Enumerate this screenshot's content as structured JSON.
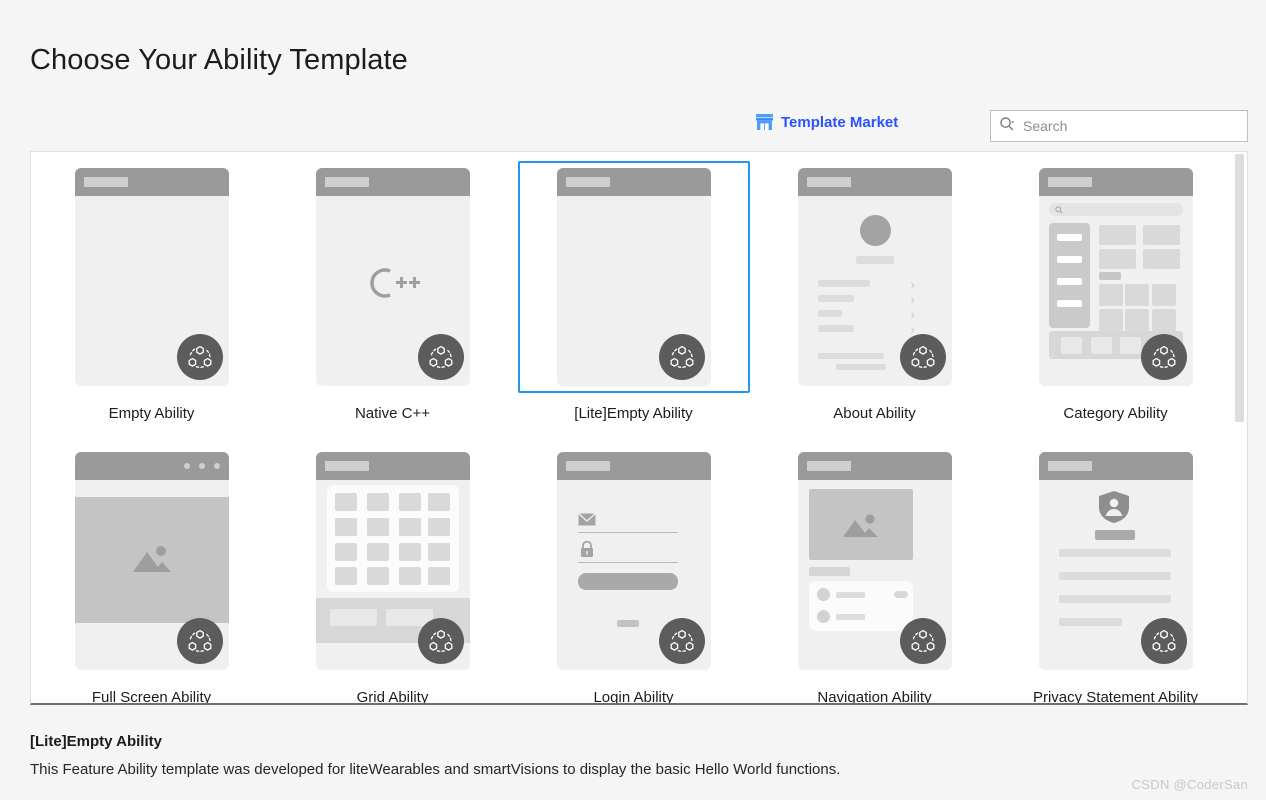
{
  "page": {
    "title": "Choose Your Ability Template",
    "background": "#f5f5f5"
  },
  "toolbar": {
    "market_link": {
      "label": "Template Market",
      "icon": "shop-icon",
      "color": "#2a53ff"
    },
    "search": {
      "placeholder": "Search",
      "value": "",
      "icon": "search-dropdown-icon"
    }
  },
  "templates": [
    {
      "label": "Empty Ability",
      "thumb": "empty",
      "selected": false
    },
    {
      "label": "Native C++",
      "thumb": "nativecpp",
      "selected": false
    },
    {
      "label": "[Lite]Empty Ability",
      "thumb": "empty",
      "selected": true
    },
    {
      "label": "About Ability",
      "thumb": "about",
      "selected": false
    },
    {
      "label": "Category Ability",
      "thumb": "category",
      "selected": false
    },
    {
      "label": "Full Screen Ability",
      "thumb": "fullscreen",
      "selected": false
    },
    {
      "label": "Grid Ability",
      "thumb": "grid",
      "selected": false
    },
    {
      "label": "Login Ability",
      "thumb": "login",
      "selected": false
    },
    {
      "label": "Navigation Ability",
      "thumb": "navigation",
      "selected": false
    },
    {
      "label": "Privacy Statement Ability",
      "thumb": "privacy",
      "selected": false
    }
  ],
  "selection": {
    "accent_color": "#2196f3",
    "name": "[Lite]Empty Ability",
    "description": "This Feature Ability template was developed for liteWearables and smartVisions to display the basic Hello World functions."
  },
  "watermark": {
    "text": "CSDN @CoderSan"
  }
}
